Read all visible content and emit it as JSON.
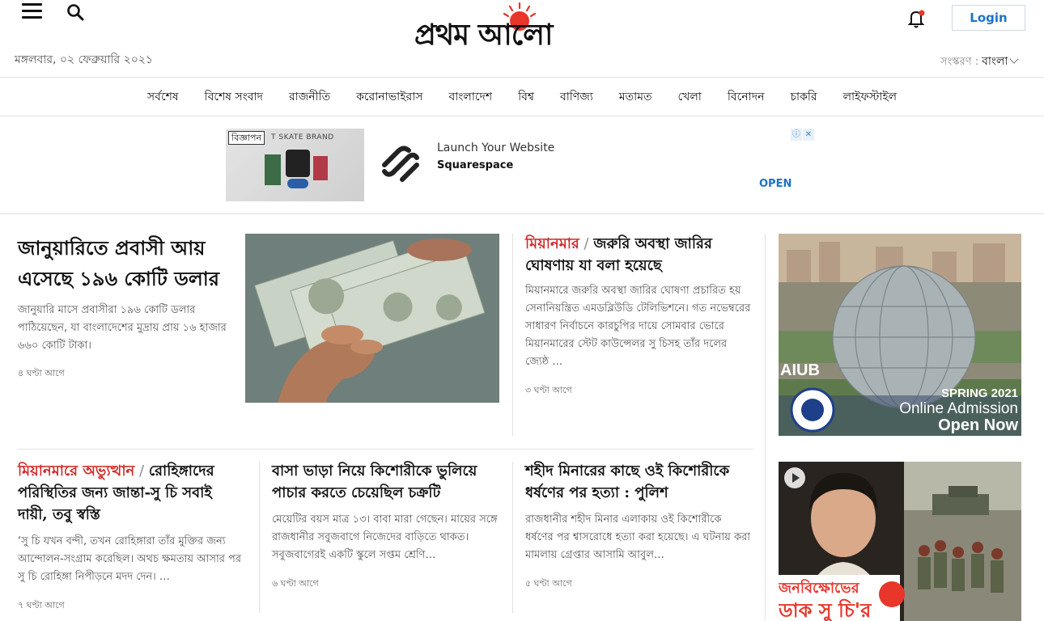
{
  "header": {
    "date": "মঙ্গলবার, ০২ ফেব্রুয়ারি ২০২১",
    "logo_text": "প্রথম আলো",
    "login_label": "Login",
    "edition_label": "সংস্করণ :",
    "edition_value": "বাংলা",
    "icons": [
      "menu-icon",
      "search-icon",
      "bell-icon",
      "chevron-down-icon"
    ]
  },
  "nav": {
    "items": [
      "সর্বশেষ",
      "বিশেষ সংবাদ",
      "রাজনীতি",
      "করোনাভাইরাস",
      "বাংলাদেশ",
      "বিশ্ব",
      "বাণিজ্য",
      "মতামত",
      "খেলা",
      "বিনোদন",
      "চাকরি",
      "লাইফস্টাইল"
    ]
  },
  "ad": {
    "label": "বিজ্ঞাপন",
    "image_text": "T SKATE BRAND",
    "line1": "Launch Your Website",
    "line2": "Squarespace",
    "cta": "OPEN"
  },
  "stories": {
    "lead": {
      "headline": "জানুয়ারিতে প্রবাসী আয় এসেছে ১৯৬ কোটি ডলার",
      "summary": "জানুয়ারি মাসে প্রবাসীরা ১৯৬ কোটি ডলার পাঠিয়েছেন, যা বাংলাদেশের মুদ্রায় প্রায় ১৬ হাজার ৬৬০ কোটি টাকা।",
      "time": "৪ ঘণ্টা আগে"
    },
    "myanmar": {
      "kicker": "মিয়ানমার",
      "headline": "জরুরি অবস্থা জারির ঘোষণায় যা বলা হয়েছে",
      "summary": "মিয়ানমারে জরুরি অবস্থা জারির ঘোষণা প্রচারিত হয় সেনানিয়ন্ত্রিত এমডব্লিউডি টেলিভিশনে। গত নভেম্বরের সাধারণ নির্বাচনে কারচুপির দায়ে সোমবার ভোরে মিয়ানমারের স্টেট কাউন্সেলর সু চিসহ তাঁর দলের জ্যেষ্ঠ …",
      "time": "৩ ঘণ্টা আগে"
    },
    "rohingya": {
      "kicker": "মিয়ানমারে অভ্যুত্থান",
      "headline": "রোহিঙ্গাদের পরিস্থিতির জন্য জান্তা-সু চি সবাই দায়ী, তবু স্বস্তি",
      "summary": "‘সু চি যখন বন্দী, তখন রোহিঙ্গারা তাঁর মুক্তির জন্য আন্দোলন-সংগ্রাম করেছিল। অথচ ক্ষমতায় আসার পর সু চি রোহিঙ্গা নিপীড়নে মদদ দেন। …",
      "time": "৭ ঘণ্টা আগে"
    },
    "teen": {
      "headline": "বাসা ভাড়া নিয়ে কিশোরীকে ভুলিয়ে পাচার করতে চেয়েছিল চক্রটি",
      "summary": "মেয়েটির বয়স মাত্র ১৩। বাবা মারা গেছেন। মায়ের সঙ্গে রাজধানীর সবুজবাগে নিজেদের বাড়িতে থাকত। সবুজবাগেরই একটি স্কুলে সপ্তম শ্রেণি…",
      "time": "৬ ঘণ্টা আগে"
    },
    "shaheed": {
      "headline": "শহীদ মিনারের কাছে ওই কিশোরীকে ধর্ষণের পর হত্যা : পুলিশ",
      "summary": "রাজধানীর শহীদ মিনার এলাকায় ওই কিশোরীকে ধর্ষণের পর শ্বাসরোধে হত্যা করা হয়েছে। এ ঘটনায় করা মামলায় গ্রেপ্তার আসামি আবুল…",
      "time": "৫ ঘণ্টা আগে"
    }
  },
  "aiub_ad": {
    "brand": "AIUB",
    "season": "SPRING 2021",
    "line1": "Online Admission",
    "line2": "Open Now"
  },
  "video_promo": {
    "caption_line1": "জনবিক্ষোভের",
    "caption_line2": "ডাক সু চি'র"
  },
  "colors": {
    "kicker_red": "#d32a2a",
    "login_blue": "#1a73c9",
    "sun_red": "#e8362a"
  }
}
